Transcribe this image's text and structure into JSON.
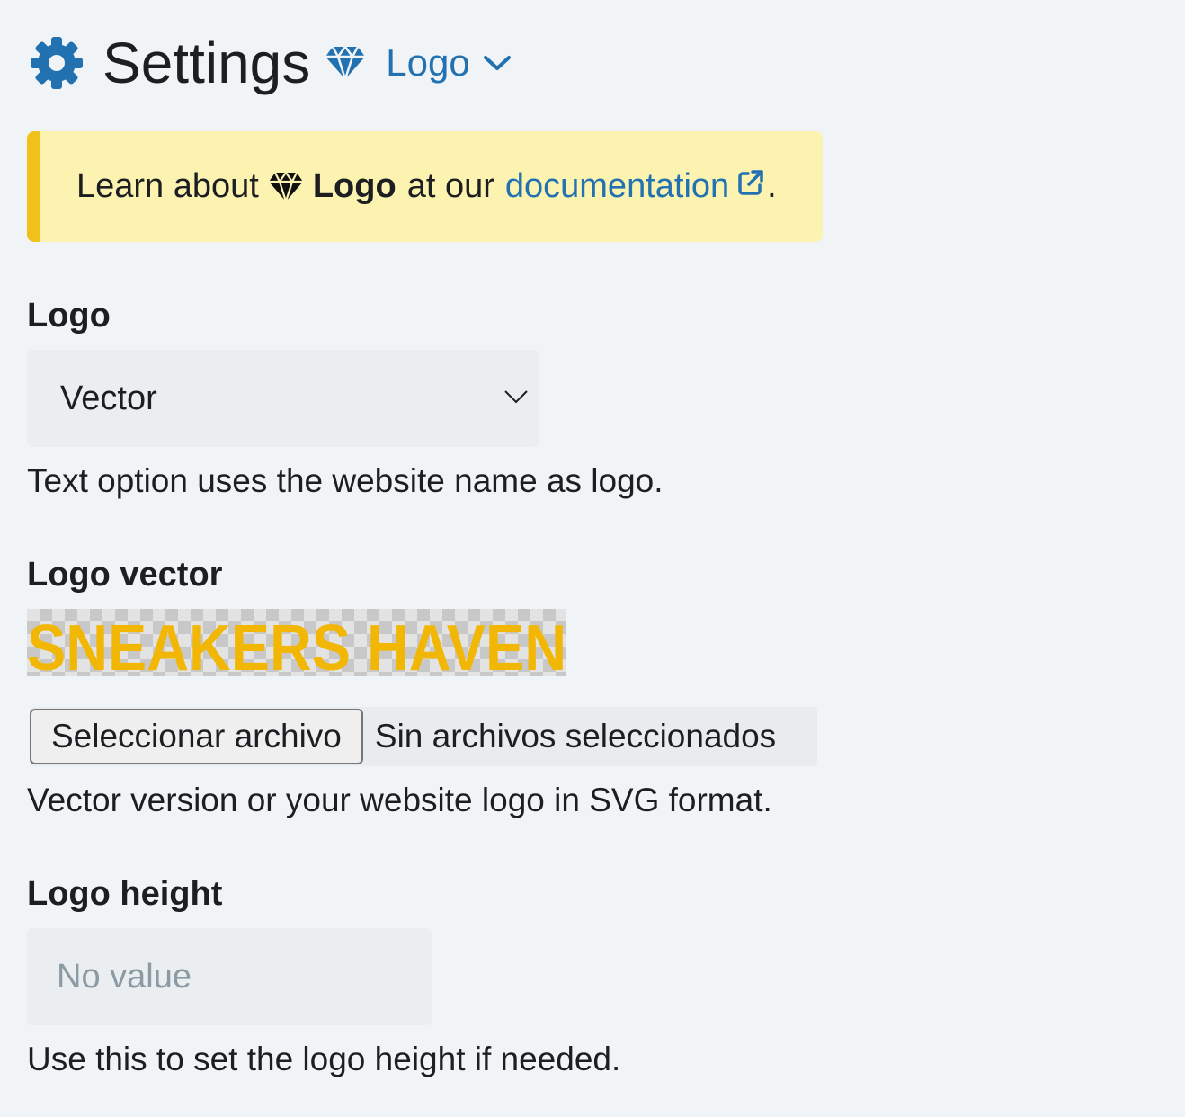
{
  "header": {
    "title": "Settings",
    "module_label": "Logo",
    "icons": [
      "gear-icon",
      "gem-icon",
      "chevron-down-icon"
    ]
  },
  "notice": {
    "prefix": "Learn about",
    "feature": "Logo",
    "middle": "at our",
    "link_text": "documentation",
    "suffix": "."
  },
  "fields": {
    "logo": {
      "label": "Logo",
      "selected": "Vector",
      "help": "Text option uses the website name as logo."
    },
    "logo_vector": {
      "label": "Logo vector",
      "preview_text": "SNEAKERS HAVEN",
      "file_button": "Seleccionar archivo",
      "file_status": "Sin archivos seleccionados",
      "help": "Vector version or your website logo in SVG format."
    },
    "logo_height": {
      "label": "Logo height",
      "placeholder": "No value",
      "help": "Use this to set the logo height if needed."
    }
  },
  "colors": {
    "accent": "#2271b1",
    "notice_bg": "#fdf3b1",
    "notice_border": "#f0c11a",
    "logo_yellow": "#f2b705"
  }
}
